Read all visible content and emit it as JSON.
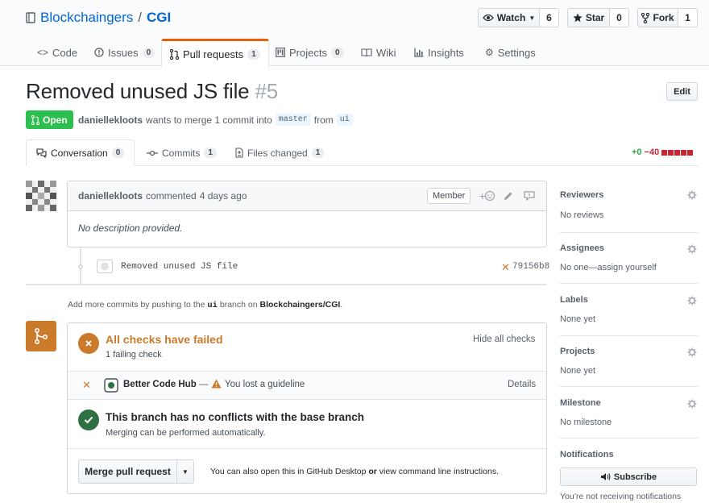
{
  "repo": {
    "owner": "Blockchaingers",
    "separator": "/",
    "name": "CGI"
  },
  "actions": {
    "watch_label": "Watch",
    "watch_count": "6",
    "star_label": "Star",
    "star_count": "0",
    "fork_label": "Fork",
    "fork_count": "1"
  },
  "tabs": [
    {
      "label": "Code",
      "icon": "code-icon"
    },
    {
      "label": "Issues",
      "count": "0",
      "icon": "issue-icon"
    },
    {
      "label": "Pull requests",
      "count": "1",
      "icon": "pull-request-icon"
    },
    {
      "label": "Projects",
      "count": "0",
      "icon": "project-icon"
    },
    {
      "label": "Wiki",
      "icon": "book-icon"
    },
    {
      "label": "Insights",
      "icon": "graph-icon"
    },
    {
      "label": "Settings",
      "icon": "gear-icon"
    }
  ],
  "pr": {
    "title": "Removed unused JS file",
    "number": "#5",
    "edit_label": "Edit",
    "state": "Open",
    "author": "daniellekloots",
    "merge_text": "wants to merge 1 commit into",
    "base_branch": "master",
    "from_text": "from",
    "head_branch": "ui"
  },
  "pr_tabs": [
    {
      "label": "Conversation",
      "count": "0"
    },
    {
      "label": "Commits",
      "count": "1"
    },
    {
      "label": "Files changed",
      "count": "1"
    }
  ],
  "diffstat": {
    "additions": "+0",
    "deletions": "−40"
  },
  "comment": {
    "author": "daniellekloots",
    "action": "commented",
    "time": "4 days ago",
    "role": "Member",
    "body": "No description provided."
  },
  "commit": {
    "message": "Removed unused JS file",
    "sha": "79156b8"
  },
  "push_hint": {
    "prefix": "Add more commits by pushing to the",
    "branch": "ui",
    "middle": "branch on",
    "repo": "Blockchaingers/CGI",
    "suffix": "."
  },
  "mergebox": {
    "checks_title": "All checks have failed",
    "checks_sub": "1 failing check",
    "hide_checks": "Hide all checks",
    "check_name": "Better Code Hub",
    "check_dash": "—",
    "check_desc": "You lost a guideline",
    "details": "Details",
    "conflict_title": "This branch has no conflicts with the base branch",
    "conflict_sub": "Merging can be performed automatically.",
    "merge_label": "Merge pull request",
    "also_prefix": "You can also",
    "also_open": "open this in GitHub Desktop",
    "also_or": "or",
    "also_view": "view command line instructions",
    "also_suffix": "."
  },
  "sidebar": {
    "reviewers": {
      "title": "Reviewers",
      "value": "No reviews"
    },
    "assignees": {
      "title": "Assignees",
      "value": "No one—assign yourself"
    },
    "labels": {
      "title": "Labels",
      "value": "None yet"
    },
    "projects": {
      "title": "Projects",
      "value": "None yet"
    },
    "milestone": {
      "title": "Milestone",
      "value": "No milestone"
    },
    "notifications": {
      "title": "Notifications",
      "subscribe": "Subscribe",
      "status": "You’re not receiving notifications"
    }
  },
  "colors": {
    "open": "#2cbe4e",
    "failing": "#cb7a2b",
    "success": "#2f6f44",
    "link": "#0366d6",
    "tab_accent": "#e36209"
  }
}
